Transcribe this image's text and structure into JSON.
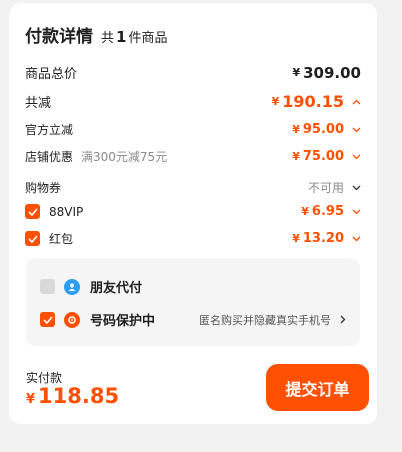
{
  "header": {
    "title": "付款详情",
    "count_prefix": "共",
    "count": "1",
    "count_suffix": "件商品"
  },
  "rows": {
    "total": {
      "label": "商品总价",
      "currency": "¥",
      "value": "309.00"
    },
    "discount": {
      "label": "共减",
      "currency": "¥",
      "value": "190.15"
    },
    "official": {
      "label": "官方立减",
      "currency": "¥",
      "value": "95.00"
    },
    "store": {
      "label": "店铺优惠",
      "detail": "满300元减75元",
      "currency": "¥",
      "value": "75.00"
    },
    "coupon": {
      "label": "购物券",
      "status": "不可用"
    },
    "vip": {
      "label": "88VIP",
      "currency": "¥",
      "value": "6.95",
      "checked": true
    },
    "redpacket": {
      "label": "红包",
      "currency": "¥",
      "value": "13.20",
      "checked": true
    }
  },
  "options": {
    "friend_pay": {
      "label": "朋友代付",
      "checked": false
    },
    "number_protect": {
      "label": "号码保护中",
      "desc": "匿名购买并隐藏真实手机号",
      "checked": true
    }
  },
  "footer": {
    "paid_label": "实付款",
    "currency": "¥",
    "amount": "118.85",
    "submit_label": "提交订单"
  },
  "colors": {
    "accent": "#ff5000",
    "friend_icon": "#2e9ef5"
  }
}
